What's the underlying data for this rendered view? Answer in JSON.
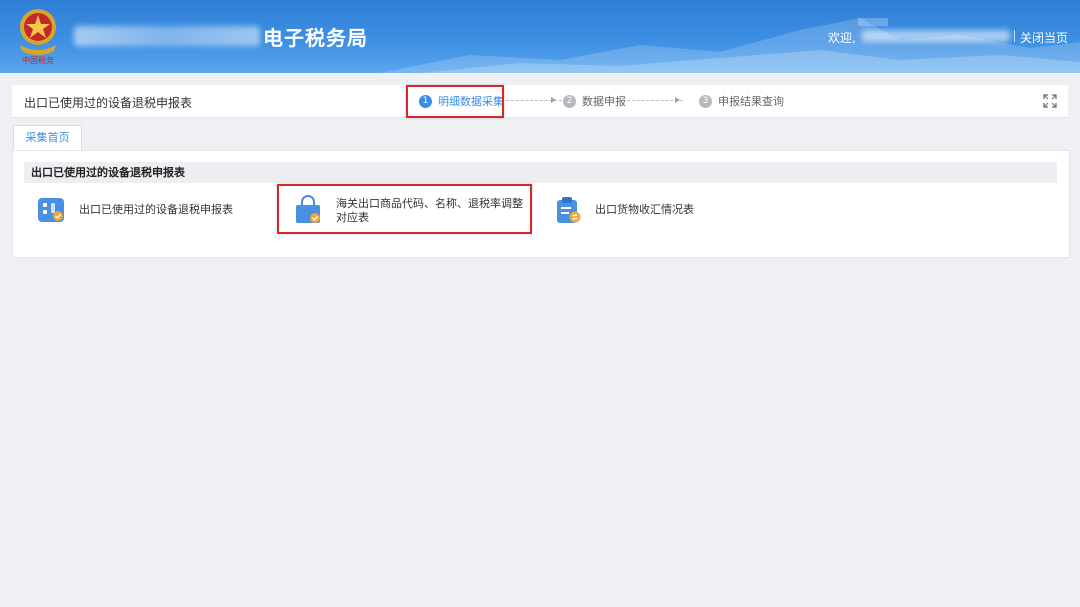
{
  "header": {
    "title": "电子税务局",
    "welcome": "欢迎,",
    "close_page": "关闭当页",
    "colors": {
      "header_blue": "#3d8fe3"
    },
    "emblem_icon": "tax-emblem-icon"
  },
  "stepbar": {
    "page_title": "出口已使用过的设备退税申报表",
    "steps": [
      {
        "num": "1",
        "label": "明细数据采集",
        "active": true
      },
      {
        "num": "2",
        "label": "数据申报",
        "active": false
      },
      {
        "num": "3",
        "label": "申报结果查询",
        "active": false
      }
    ],
    "expand_icon": "expand-icon"
  },
  "tabs": [
    {
      "label": "采集首页",
      "active": true
    }
  ],
  "section": {
    "heading": "出口已使用过的设备退税申报表",
    "items": [
      {
        "label": "出口已使用过的设备退税申报表",
        "icon": "device-form-icon",
        "color": "#4a90e2"
      },
      {
        "label": "海关出口商品代码、名称、退税率调整对应表",
        "icon": "shopping-bag-icon",
        "color": "#4a90e2"
      },
      {
        "label": "出口货物收汇情况表",
        "icon": "clipboard-exchange-icon",
        "color": "#4a90e2"
      }
    ]
  },
  "accent_color": "#3b8ee8",
  "highlight_color": "#d9262b"
}
